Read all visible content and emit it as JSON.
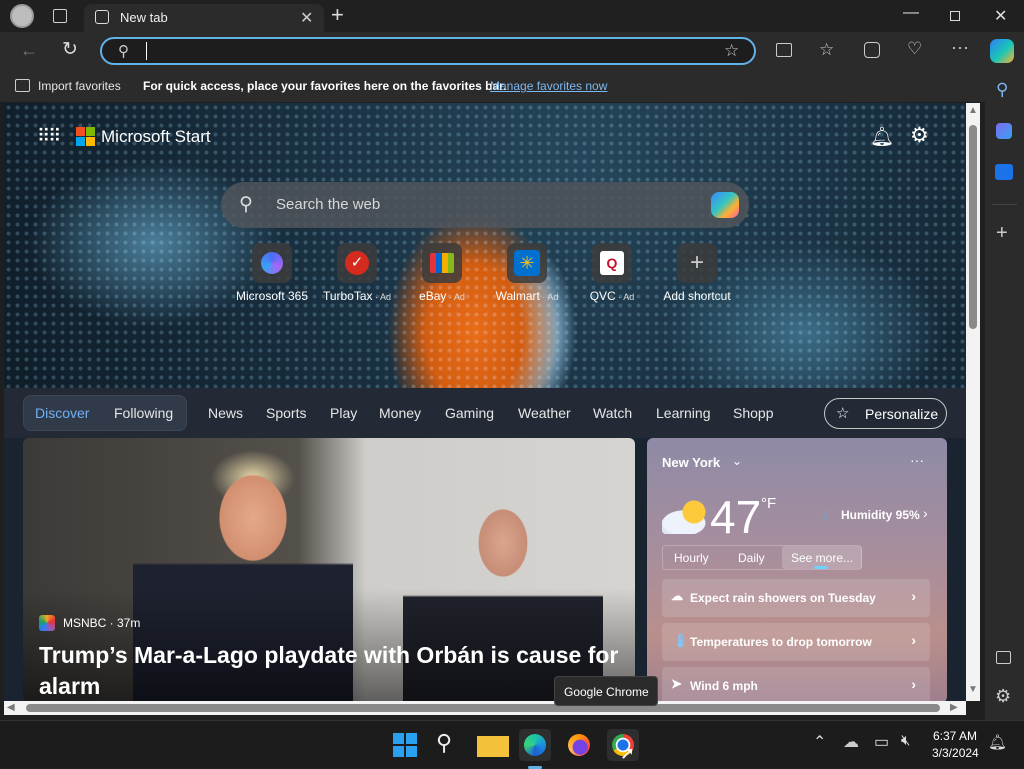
{
  "tab": {
    "title": "New tab"
  },
  "address_bar": {
    "value": "",
    "placeholder": ""
  },
  "favorites_bar": {
    "import_label": "Import favorites",
    "message": "For quick access, place your favorites here on the favorites bar.",
    "manage_link": "Manage favorites now"
  },
  "page": {
    "brand": "Microsoft Start",
    "search_placeholder": "Search the web",
    "shortcuts": [
      {
        "label": "Microsoft 365",
        "ad": ""
      },
      {
        "label": "TurboTax",
        "ad": "Ad"
      },
      {
        "label": "eBay",
        "ad": "Ad"
      },
      {
        "label": "Walmart",
        "ad": "Ad"
      },
      {
        "label": "QVC",
        "ad": "Ad"
      },
      {
        "label": "Add shortcut",
        "ad": ""
      }
    ],
    "nav": {
      "discover": "Discover",
      "following": "Following",
      "items": [
        "News",
        "Sports",
        "Play",
        "Money",
        "Gaming",
        "Weather",
        "Watch",
        "Learning",
        "Shopp"
      ],
      "personalize": "Personalize"
    },
    "news": {
      "source": "MSNBC · 37m",
      "headline": "Trump’s Mar-a-Lago playdate with Orbán is cause for alarm"
    },
    "weather": {
      "location": "New York",
      "temp": "47",
      "unit": "°F",
      "humidity": "Humidity 95%",
      "tabs": [
        "Hourly",
        "Daily",
        "See more..."
      ],
      "rows": [
        "Expect rain showers on Tuesday",
        "Temperatures to drop tomorrow",
        "Wind 6 mph"
      ]
    }
  },
  "tooltip": "Google Chrome",
  "taskbar": {
    "time": "6:37 AM",
    "date": "3/3/2024"
  },
  "colors": {
    "accent": "#60b3e8",
    "link": "#7cb8f0",
    "discover": "#6fb1f5"
  }
}
